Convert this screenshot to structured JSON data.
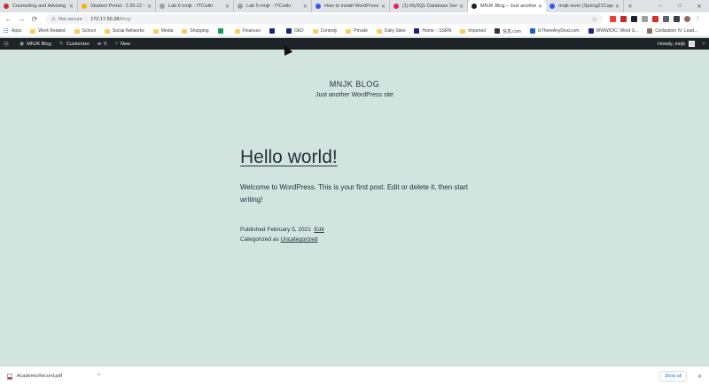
{
  "browser": {
    "tabs": [
      {
        "title": "Counseling and Advising - ...",
        "favicon_color": "#c0392b",
        "active": false
      },
      {
        "title": "Student Portal - 2.26.12 - A...",
        "favicon_color": "#f4b400",
        "active": false
      },
      {
        "title": "Lab 6 mnjk - ITCwiki",
        "favicon_color": "#9e9e9e",
        "active": false
      },
      {
        "title": "Lab 5 mnjk - ITCwiki",
        "favicon_color": "#9e9e9e",
        "active": false
      },
      {
        "title": "How to install WordPress | ...",
        "favicon_color": "#3858e9",
        "active": false
      },
      {
        "title": "(1) MySQL Database Server...",
        "favicon_color": "#e0245e",
        "active": false
      },
      {
        "title": "MNJK Blog – Just another W...",
        "favicon_color": "#1d2327",
        "active": true
      },
      {
        "title": "mnjk-inver (Spring21Capst...",
        "favicon_color": "#3858e9",
        "active": false
      }
    ],
    "new_tab_label": "+",
    "window_controls": [
      "–",
      "□",
      "✕"
    ],
    "toolbar": {
      "back": "←",
      "forward": "→",
      "reload": "⟳",
      "security_icon": "⚠",
      "not_secure_label": "Not secure",
      "url_host": "172.17.50.28",
      "url_path": "/blog/",
      "star": "☆"
    },
    "bookmarks": [
      {
        "label": "Apps",
        "type": "apps"
      },
      {
        "label": "Work Related",
        "type": "folder"
      },
      {
        "label": "School",
        "type": "folder"
      },
      {
        "label": "Social Networks",
        "type": "folder"
      },
      {
        "label": "Media",
        "type": "folder"
      },
      {
        "label": "Shopping",
        "type": "folder"
      },
      {
        "label": "",
        "type": "site",
        "color": "#0f9d58"
      },
      {
        "label": "Finances",
        "type": "folder"
      },
      {
        "label": "",
        "type": "site",
        "color": "#1a237e"
      },
      {
        "label": "OED",
        "type": "site",
        "color": "#1a237e"
      },
      {
        "label": "Comedy",
        "type": "folder"
      },
      {
        "label": "Private",
        "type": "folder"
      },
      {
        "label": "Daily Sites",
        "type": "folder"
      },
      {
        "label": "Home :: SSRN",
        "type": "site",
        "color": "#1a237e"
      },
      {
        "label": "Imported",
        "type": "folder"
      },
      {
        "label": "信息.com",
        "type": "site",
        "color": "#333333"
      },
      {
        "label": "IsThereAnyDeal.com",
        "type": "site",
        "color": "#1565c0"
      },
      {
        "label": "WWW/DIC: Word S...",
        "type": "site",
        "color": "#1a237e"
      },
      {
        "label": "Civilization IV: Lead...",
        "type": "site",
        "color": "#8d6e63"
      }
    ]
  },
  "adminbar": {
    "wp_logo": "Ⓦ",
    "site_name": "MNJK Blog",
    "customize": "Customize",
    "comments_count": "0",
    "new_label": "New",
    "howdy": "Howdy, mnjk",
    "search_icon": "⌕"
  },
  "site": {
    "title": "MNJK BLOG",
    "description": "Just another WordPress site"
  },
  "post": {
    "title": "Hello world!",
    "body": "Welcome to WordPress. This is your first post. Edit or delete it, then start writing!",
    "published_label": "Published",
    "published_date": "February 5, 2021",
    "edit_label": "Edit",
    "categorized_label": "Categorized as",
    "category": "Uncategorized"
  },
  "downloads": {
    "file_name": "AcademicRecord.pdf",
    "chevron": "^",
    "show_all": "Show all",
    "close": "✕"
  }
}
